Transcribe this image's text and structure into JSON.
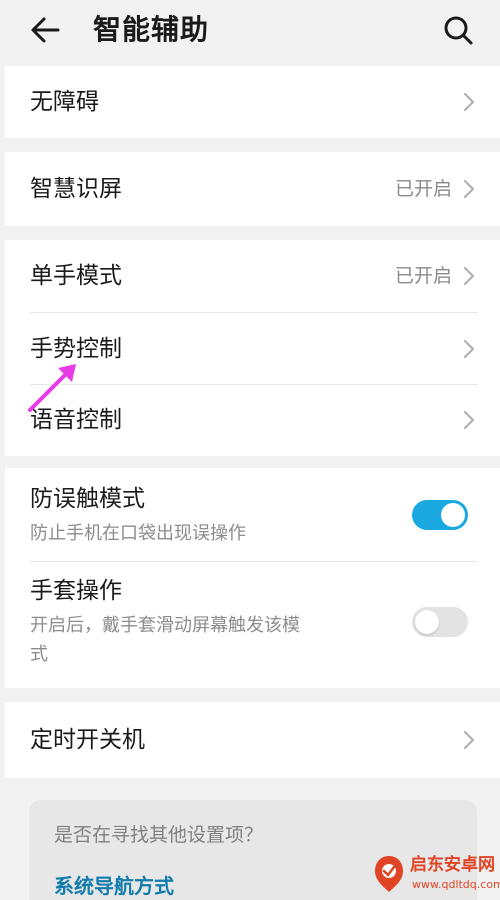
{
  "header": {
    "title": "智能辅助",
    "back_icon": "arrow-left-icon",
    "search_icon": "search-icon"
  },
  "sections": [
    {
      "items": [
        {
          "label": "无障碍",
          "status": "",
          "type": "nav"
        }
      ]
    },
    {
      "items": [
        {
          "label": "智慧识屏",
          "status": "已开启",
          "type": "nav"
        }
      ]
    },
    {
      "items": [
        {
          "label": "单手模式",
          "status": "已开启",
          "type": "nav"
        },
        {
          "label": "手势控制",
          "status": "",
          "type": "nav"
        },
        {
          "label": "语音控制",
          "status": "",
          "type": "nav"
        }
      ]
    },
    {
      "items": [
        {
          "label": "防误触模式",
          "subtitle": "防止手机在口袋出现误操作",
          "type": "toggle",
          "on": true
        },
        {
          "label": "手套操作",
          "subtitle_line1": "开启后，戴手套滑动屏幕触发该模",
          "subtitle_line2": "式",
          "type": "toggle",
          "on": false
        }
      ]
    },
    {
      "items": [
        {
          "label": "定时开关机",
          "status": "",
          "type": "nav"
        }
      ]
    }
  ],
  "suggestion": {
    "title": "是否在寻找其他设置项？",
    "link": "系统导航方式"
  },
  "watermark": {
    "brand": "启东安卓网",
    "url": "www.qdltdq.com"
  },
  "colors": {
    "accent": "#1aa8e0",
    "link": "#127dac",
    "annotation_arrow": "#e83ae6",
    "watermark": "#e04424"
  }
}
